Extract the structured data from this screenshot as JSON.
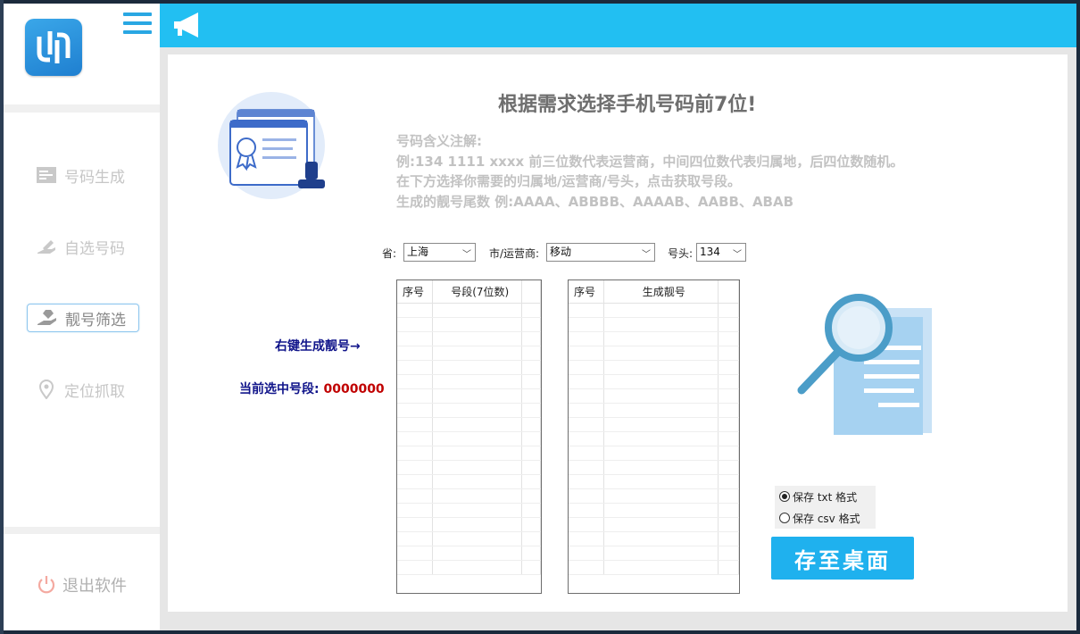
{
  "sidebar": {
    "items": [
      {
        "label": "号码生成",
        "icon": "list-icon",
        "active": false
      },
      {
        "label": "自选号码",
        "icon": "hand-pen-icon",
        "active": false
      },
      {
        "label": "靓号筛选",
        "icon": "hand-gem-icon",
        "active": true
      },
      {
        "label": "定位抓取",
        "icon": "location-pin-icon",
        "active": false
      }
    ],
    "exit_label": "退出软件"
  },
  "main": {
    "title": "根据需求选择手机号码前7位!",
    "notes": [
      "号码含义注解:",
      "例:134 1111 xxxx  前三位数代表运营商，中间四位数代表归属地，后四位数随机。",
      "在下方选择你需要的归属地/运营商/号头，点击获取号段。",
      "生成的靓号尾数 例:AAAA、ABBBB、AAAAB、AABB、ABAB"
    ],
    "filters": {
      "province_label": "省:",
      "province_value": "上海",
      "city_label": "市/运营商:",
      "city_value": "移动",
      "prefix_label": "号头:",
      "prefix_value": "134"
    },
    "right_click_hint": "右键生成靓号→",
    "current_segment_label": "当前选中号段:",
    "current_segment_value": "0000000",
    "segment_table": {
      "headers": [
        "序号",
        "号段(7位数)"
      ],
      "rows": []
    },
    "result_table": {
      "headers": [
        "序号",
        "生成靓号"
      ],
      "rows": []
    },
    "save_options": [
      {
        "label": "保存 txt 格式",
        "checked": true
      },
      {
        "label": "保存 csv 格式",
        "checked": false
      }
    ],
    "save_button": "存至桌面"
  },
  "colors": {
    "topbar": "#22bff2",
    "accent": "#1fb1ee",
    "hint_blue": "#10148a",
    "value_red": "#c00000"
  }
}
